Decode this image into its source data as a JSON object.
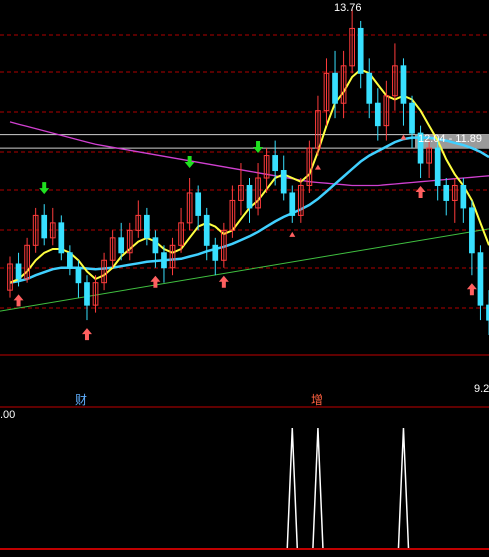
{
  "colors": {
    "background": "#000000",
    "up": "#ff3c3c",
    "down": "#38e0ff",
    "ma_short": "#ffff40",
    "ma_mid": "#40d0ff",
    "ma_long": "#d040d0",
    "trendline": "#40c040",
    "grid": "#b00000",
    "divider": "#c00000",
    "price_line": "#d0d0d0",
    "text_white": "#ffffff",
    "label_cai": "#60b0ff",
    "label_zeng": "#ff6040",
    "signal_green": "#20e020",
    "signal_red": "#ff6060",
    "osc_line": "#ffffff"
  },
  "annotations": {
    "high_price": "13.76",
    "range_label": "12.04 - 11.89",
    "marker_cai": "财",
    "marker_zeng": "增",
    "axis_value": "9.2",
    "osc_axis_value": ".00"
  },
  "chart_data": [
    {
      "type": "candlestick",
      "y_range": [
        9.2,
        13.8
      ],
      "candles": [
        [
          10.0,
          10.35,
          9.9,
          10.45
        ],
        [
          10.35,
          10.15,
          10.05,
          10.5
        ],
        [
          10.15,
          10.6,
          10.1,
          10.7
        ],
        [
          10.6,
          11.0,
          10.5,
          11.1
        ],
        [
          11.0,
          10.7,
          10.6,
          11.15
        ],
        [
          10.7,
          10.9,
          10.6,
          11.1
        ],
        [
          10.9,
          10.5,
          10.4,
          11.0
        ],
        [
          10.5,
          10.3,
          10.2,
          10.6
        ],
        [
          10.3,
          10.1,
          9.9,
          10.4
        ],
        [
          10.1,
          9.8,
          9.6,
          10.2
        ],
        [
          9.8,
          10.1,
          9.7,
          10.2
        ],
        [
          10.1,
          10.4,
          10.0,
          10.5
        ],
        [
          10.4,
          10.7,
          10.3,
          10.8
        ],
        [
          10.7,
          10.5,
          10.4,
          10.9
        ],
        [
          10.5,
          10.8,
          10.4,
          10.9
        ],
        [
          10.8,
          11.0,
          10.7,
          11.2
        ],
        [
          11.0,
          10.7,
          10.6,
          11.1
        ],
        [
          10.7,
          10.5,
          10.3,
          10.8
        ],
        [
          10.5,
          10.3,
          10.1,
          10.6
        ],
        [
          10.3,
          10.6,
          10.2,
          10.7
        ],
        [
          10.6,
          10.9,
          10.5,
          11.1
        ],
        [
          10.9,
          11.3,
          10.8,
          11.5
        ],
        [
          11.3,
          11.0,
          10.8,
          11.4
        ],
        [
          11.0,
          10.6,
          10.4,
          11.1
        ],
        [
          10.6,
          10.4,
          10.2,
          10.7
        ],
        [
          10.4,
          10.8,
          10.3,
          10.9
        ],
        [
          10.8,
          11.2,
          10.7,
          11.4
        ],
        [
          11.2,
          11.4,
          11.0,
          11.7
        ],
        [
          11.4,
          11.1,
          10.9,
          11.5
        ],
        [
          11.1,
          11.5,
          11.0,
          11.7
        ],
        [
          11.5,
          11.8,
          11.3,
          11.9
        ],
        [
          11.8,
          11.6,
          11.4,
          12.0
        ],
        [
          11.6,
          11.3,
          11.2,
          11.8
        ],
        [
          11.3,
          11.0,
          10.9,
          11.4
        ],
        [
          11.0,
          11.4,
          10.9,
          11.5
        ],
        [
          11.4,
          11.9,
          11.3,
          12.0
        ],
        [
          11.9,
          12.4,
          11.8,
          12.6
        ],
        [
          12.4,
          12.9,
          12.2,
          13.1
        ],
        [
          12.9,
          12.5,
          12.3,
          13.2
        ],
        [
          12.5,
          13.0,
          12.3,
          13.2
        ],
        [
          13.0,
          13.5,
          12.9,
          13.76
        ],
        [
          13.5,
          12.9,
          12.7,
          13.6
        ],
        [
          12.9,
          12.5,
          12.3,
          13.1
        ],
        [
          12.5,
          12.2,
          12.0,
          12.7
        ],
        [
          12.2,
          12.6,
          12.0,
          12.8
        ],
        [
          12.6,
          13.0,
          12.4,
          13.3
        ],
        [
          13.0,
          12.5,
          12.2,
          13.1
        ],
        [
          12.5,
          12.1,
          11.9,
          12.6
        ],
        [
          12.1,
          11.7,
          11.5,
          12.2
        ],
        [
          11.7,
          11.9,
          11.5,
          12.0
        ],
        [
          11.9,
          11.4,
          11.2,
          12.0
        ],
        [
          11.4,
          11.2,
          11.0,
          11.5
        ],
        [
          11.2,
          11.4,
          10.9,
          11.5
        ],
        [
          11.4,
          11.1,
          10.9,
          11.5
        ],
        [
          11.1,
          10.5,
          10.2,
          11.2
        ],
        [
          10.5,
          9.8,
          9.6,
          10.6
        ],
        [
          9.8,
          9.6,
          9.4,
          10.0
        ]
      ],
      "ma_short": [
        10.1,
        10.15,
        10.25,
        10.4,
        10.5,
        10.55,
        10.55,
        10.5,
        10.4,
        10.25,
        10.15,
        10.2,
        10.3,
        10.45,
        10.55,
        10.65,
        10.7,
        10.65,
        10.55,
        10.5,
        10.55,
        10.7,
        10.85,
        10.9,
        10.85,
        10.75,
        10.8,
        10.95,
        11.1,
        11.2,
        11.35,
        11.5,
        11.55,
        11.5,
        11.45,
        11.55,
        11.85,
        12.2,
        12.5,
        12.65,
        12.85,
        12.95,
        12.9,
        12.75,
        12.6,
        12.55,
        12.6,
        12.55,
        12.4,
        12.2,
        12.0,
        11.75,
        11.55,
        11.4,
        11.2,
        10.9,
        10.6
      ],
      "ma_mid": [
        10.1,
        10.12,
        10.15,
        10.2,
        10.24,
        10.28,
        10.3,
        10.3,
        10.3,
        10.29,
        10.28,
        10.29,
        10.3,
        10.32,
        10.34,
        10.36,
        10.38,
        10.39,
        10.4,
        10.41,
        10.42,
        10.45,
        10.48,
        10.52,
        10.55,
        10.58,
        10.62,
        10.67,
        10.72,
        10.78,
        10.85,
        10.92,
        10.98,
        11.03,
        11.08,
        11.14,
        11.22,
        11.32,
        11.42,
        11.52,
        11.62,
        11.72,
        11.8,
        11.86,
        11.92,
        11.98,
        12.02,
        12.04,
        12.04,
        12.04,
        12.02,
        12.0,
        11.97,
        11.94,
        11.9,
        11.85,
        11.78
      ],
      "ma_long": [
        12.25,
        12.22,
        12.19,
        12.16,
        12.13,
        12.1,
        12.07,
        12.04,
        12.01,
        11.98,
        11.95,
        11.93,
        11.91,
        11.89,
        11.87,
        11.85,
        11.83,
        11.81,
        11.79,
        11.77,
        11.75,
        11.73,
        11.71,
        11.69,
        11.67,
        11.65,
        11.63,
        11.61,
        11.59,
        11.57,
        11.55,
        11.53,
        11.51,
        11.49,
        11.47,
        11.45,
        11.44,
        11.43,
        11.42,
        11.41,
        11.4,
        11.4,
        11.4,
        11.4,
        11.41,
        11.42,
        11.43,
        11.44,
        11.45,
        11.46,
        11.47,
        11.48,
        11.49,
        11.5,
        11.51,
        11.52,
        11.53
      ],
      "trendline": [
        9.72,
        10.82
      ],
      "price_lines": [
        12.08,
        11.9
      ],
      "down_arrows": [
        4,
        21,
        29
      ],
      "up_arrows": [
        1,
        9,
        17,
        25,
        48,
        54
      ],
      "signal_points": [
        33,
        36,
        46
      ]
    },
    {
      "type": "line",
      "name": "oscillator",
      "y_range": [
        0,
        1
      ],
      "spikes": [
        33,
        36,
        46
      ]
    }
  ]
}
